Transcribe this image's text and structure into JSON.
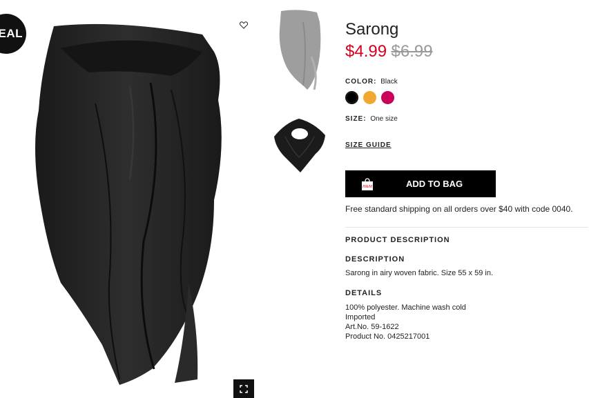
{
  "badge": {
    "text": "EAL"
  },
  "product": {
    "title": "Sarong",
    "price_sale": "$4.99",
    "price_original": "$6.99"
  },
  "color": {
    "label": "COLOR:",
    "selected": "Black",
    "swatches": [
      {
        "name": "Black",
        "hex": "#000000",
        "selected": true
      },
      {
        "name": "Yellow",
        "hex": "#f0a930",
        "selected": false
      },
      {
        "name": "Pink",
        "hex": "#c8005a",
        "selected": false
      }
    ]
  },
  "size": {
    "label": "SIZE:",
    "value": "One size"
  },
  "size_guide": {
    "label": "SIZE GUIDE"
  },
  "add_to_bag": {
    "label": "ADD TO BAG"
  },
  "shipping": {
    "text": "Free standard shipping on all orders over $40 with code 0040."
  },
  "product_description": {
    "heading": "PRODUCT DESCRIPTION",
    "description_heading": "DESCRIPTION",
    "description_text": "Sarong in airy woven fabric. Size 55 x 59 in.",
    "details_heading": "DETAILS",
    "details": [
      "100% polyester. Machine wash cold",
      "Imported",
      "Art.No. 59-1622",
      "Product No. 0425217001"
    ]
  },
  "colors": {
    "sale": "#d6001c",
    "button": "#000000"
  }
}
